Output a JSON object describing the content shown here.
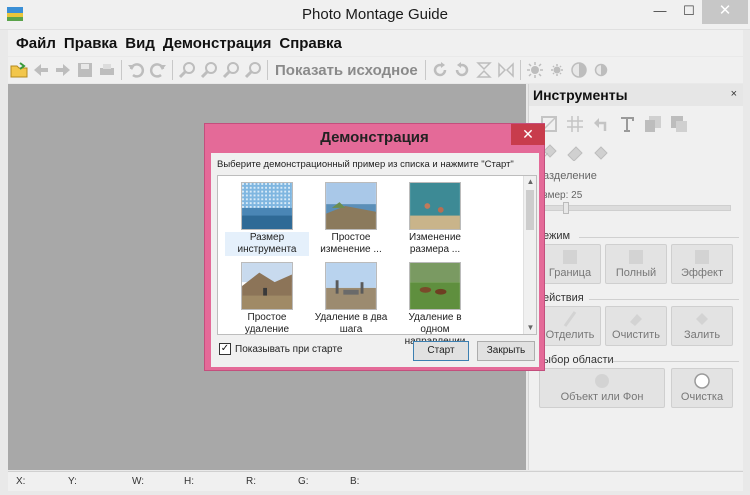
{
  "window": {
    "title": "Photo Montage Guide",
    "min_glyph": "—",
    "max_glyph": "☐",
    "close_glyph": "✕"
  },
  "menu": [
    "Файл",
    "Правка",
    "Вид",
    "Демонстрация",
    "Справка"
  ],
  "toolbar": {
    "show_original_label": "Показать исходное",
    "icons": [
      "open-icon",
      "back-icon",
      "forward-icon",
      "save-icon",
      "print-icon",
      "undo-icon",
      "redo-icon",
      "zoom-in-icon",
      "zoom-out-icon",
      "zoom-fit-icon",
      "zoom-actual-icon",
      "rotate-right-icon",
      "rotate-left-icon",
      "flip-vertical-icon",
      "flip-horizontal-icon",
      "brightness-icon",
      "settings-icon",
      "contrast-icon",
      "saturation-icon"
    ]
  },
  "panel": {
    "title": "Инструменты",
    "close_glyph": "×",
    "section_split": "азделение",
    "size_label": "змер: 25",
    "size_value": 25,
    "section_mode": "ежим",
    "mode_buttons": [
      "Граница",
      "Полный",
      "Эффект"
    ],
    "section_actions": "ействия",
    "action_buttons": [
      "Отделить",
      "Очистить",
      "Залить"
    ],
    "section_area": "ыбор области",
    "area_buttons": [
      "Объект или Фон",
      "Очистка"
    ]
  },
  "statusbar": {
    "x": "X:",
    "y": "Y:",
    "w": "W:",
    "h": "H:",
    "r": "R:",
    "g": "G:",
    "b": "B:"
  },
  "dialog": {
    "title": "Демонстрация",
    "close_glyph": "✕",
    "instruction": "Выберите демонстрационный пример из списка и нажмите \"Старт\"",
    "items": [
      {
        "label_1": "Размер",
        "label_2": "инструмента",
        "selected": true
      },
      {
        "label_1": "Простое",
        "label_2": "изменение ...",
        "selected": false
      },
      {
        "label_1": "Изменение",
        "label_2": "размера ...",
        "selected": false
      },
      {
        "label_1": "Простое удаление",
        "label_2": "",
        "selected": false
      },
      {
        "label_1": "Удаление в два",
        "label_2": "шага",
        "selected": false
      },
      {
        "label_1": "Удаление в одном",
        "label_2": "направлении",
        "selected": false
      }
    ],
    "show_on_start_label": "Показывать при старте",
    "show_on_start_checked": true,
    "check_glyph": "✓",
    "start_label": "Старт",
    "close_label": "Закрыть",
    "scroll_up": "▲",
    "scroll_down": "▼"
  },
  "colors": {
    "dialog_frame": "#e46a98",
    "canvas": "#a8a8a8",
    "close_red": "#c83c4c"
  }
}
